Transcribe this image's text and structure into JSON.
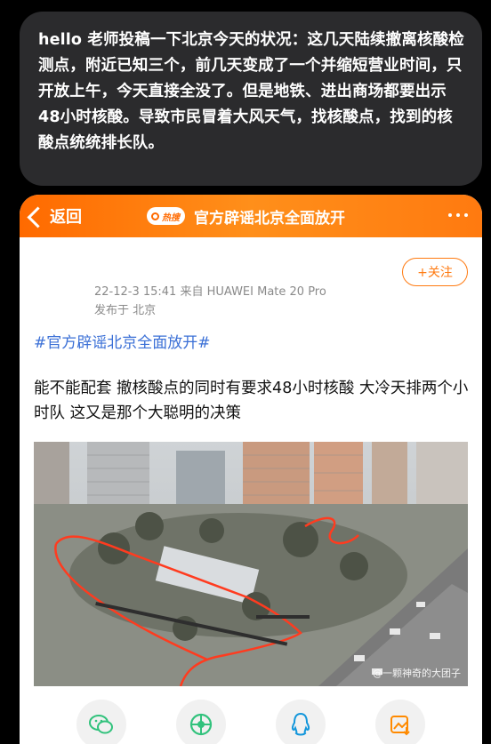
{
  "message": {
    "text": "hello 老师投稿一下北京今天的状况：这几天陆续撤离核酸检测点，附近已知三个，前几天变成了一个并缩短营业时间，只开放上午，今天直接全没了。但是地铁、进出商场都要出示48小时核酸。导致市民冒着大风天气，找核酸点，找到的核酸点统统排长队。"
  },
  "post": {
    "back_label": "返回",
    "hot_badge": "热搜",
    "title": "官方辟谣北京全面放开",
    "follow_label": "+关注",
    "meta_line": "22-12-3 15:41  来自 HUAWEI Mate 20 Pro",
    "location": "发布于 北京",
    "hashtag": "#官方辟谣北京全面放开#",
    "body": "能不能配套 撤核酸点的同时有要求48小时核酸 大冷天排两个小时队 这又是那个大聪明的决策",
    "photo_watermark": "@一颗神奇的大团子"
  },
  "share": [
    {
      "icon": "wechat-icon",
      "color": "#31c27c"
    },
    {
      "icon": "moments-icon",
      "color": "#31c27c"
    },
    {
      "icon": "qq-icon",
      "color": "#1296db"
    },
    {
      "icon": "save-image-icon",
      "color": "#ff8a00"
    }
  ],
  "colors": {
    "accent": "#ff7a10",
    "link": "#3a6fd6",
    "bubble": "#2b2b2d"
  }
}
